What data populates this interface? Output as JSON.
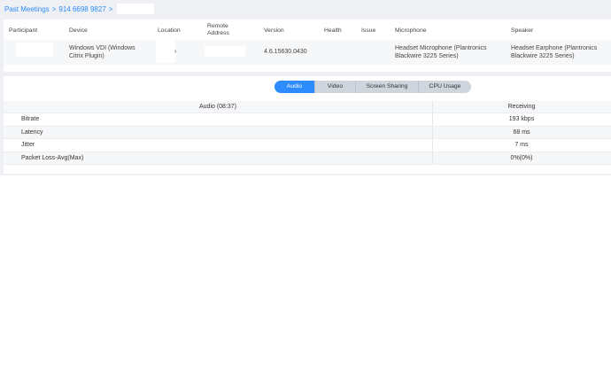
{
  "breadcrumb": {
    "past_meetings": "Past Meetings",
    "separator": ">",
    "meeting_id": "914 6698 9827"
  },
  "participants": {
    "headers": {
      "participant": "Participant",
      "device": "Device",
      "location": "Location",
      "remote_address": "Remote Address",
      "version": "Version",
      "health": "Health",
      "issue": "Issue",
      "microphone": "Microphone",
      "speaker": "Speaker"
    },
    "row": {
      "device": "Windows VDI (Windows Citrix Plugin)",
      "location_suffix": "›",
      "version": "4.6.15630.0430",
      "health": "",
      "issue": "",
      "microphone": "Headset Microphone (Plantronics Blackwire 3225 Series)",
      "speaker": "Headset Earphone (Plantronics Blackwire 3225 Series)"
    }
  },
  "tabs": [
    {
      "label": "Audio",
      "active": true
    },
    {
      "label": "Video",
      "active": false
    },
    {
      "label": "Screen Sharing",
      "active": false
    },
    {
      "label": "CPU Usage",
      "active": false
    }
  ],
  "metrics": {
    "header_title": "Audio (08:37)",
    "header_receiving": "Receiving",
    "rows": [
      {
        "label": "Bitrate",
        "value": "193 kbps"
      },
      {
        "label": "Latency",
        "value": "68 ms"
      },
      {
        "label": "Jitter",
        "value": "7 ms"
      },
      {
        "label": "Packet Loss-Avg(Max)",
        "value": "0%(0%)"
      }
    ]
  },
  "colors": {
    "accent": "#2d8cff",
    "tab_inactive": "#cfd5dd",
    "band": "#eef0f3"
  }
}
